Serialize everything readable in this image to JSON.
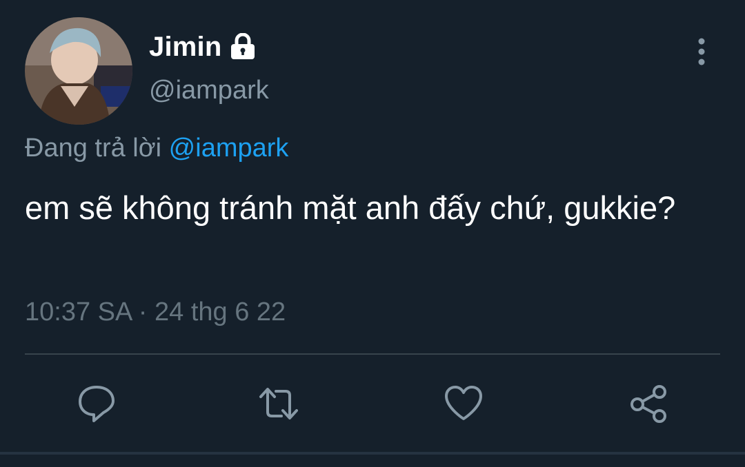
{
  "tweet": {
    "display_name": "Jimin",
    "handle": "@iampark",
    "protected_icon": "lock-icon",
    "reply_prefix": "Đang trả lời",
    "reply_to": "@iampark",
    "text": "em sẽ không tránh mặt anh đấy chứ, gukkie?",
    "timestamp": "10:37 SA · 24 thg 6 22"
  },
  "actions": [
    {
      "icon": "reply-icon"
    },
    {
      "icon": "retweet-icon"
    },
    {
      "icon": "like-icon"
    },
    {
      "icon": "share-icon"
    }
  ],
  "colors": {
    "background": "#15202b",
    "secondary_text": "#8899a6",
    "link": "#1da1f2",
    "divider": "#38444d"
  }
}
